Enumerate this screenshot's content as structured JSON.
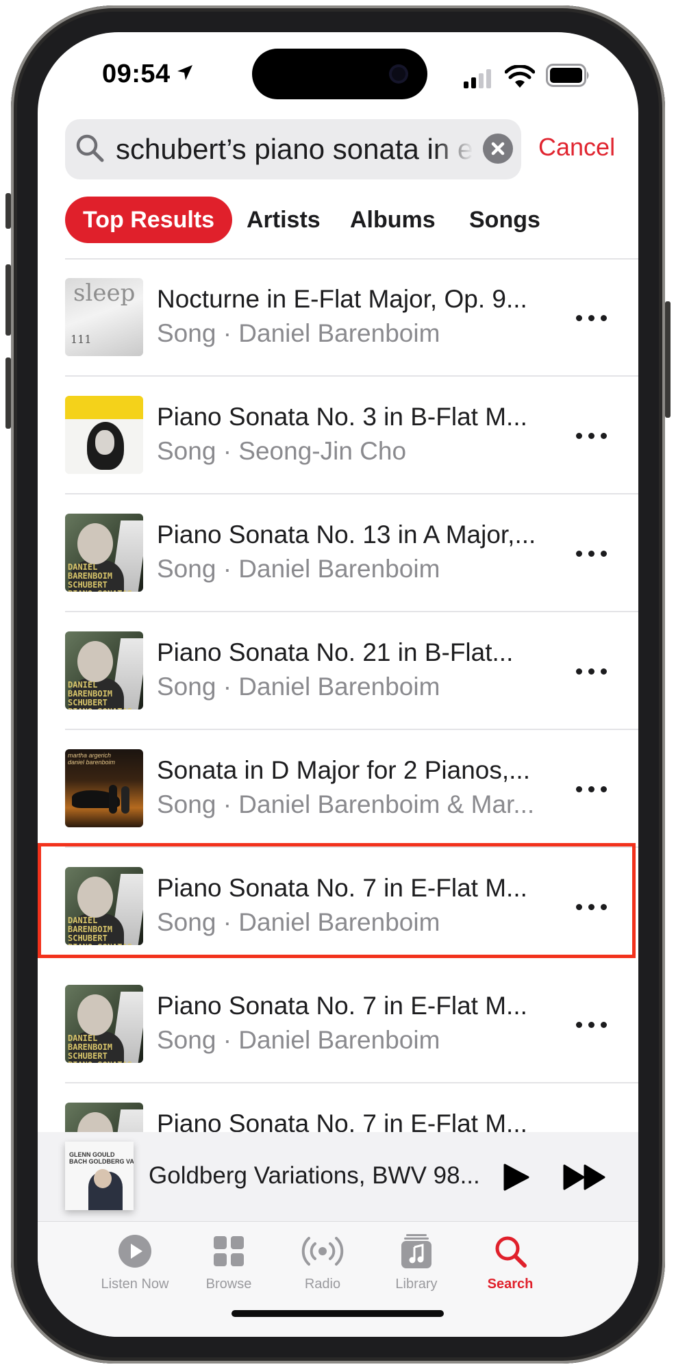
{
  "status_bar": {
    "time": "09:54"
  },
  "search": {
    "query": "schubert’s piano sonata in e",
    "cancel_label": "Cancel"
  },
  "tabs": [
    {
      "label": "Top Results",
      "active": true
    },
    {
      "label": "Artists",
      "active": false
    },
    {
      "label": "Albums",
      "active": false
    },
    {
      "label": "Songs",
      "active": false
    }
  ],
  "results": [
    {
      "title": "Nocturne in E-Flat Major, Op. 9...",
      "subtitle": "Song · Daniel Barenboim",
      "art": "sleep",
      "art_text": "sleep",
      "art_number": "111"
    },
    {
      "title": "Piano Sonata No. 3 in B-Flat M...",
      "subtitle": "Song · Seong-Jin Cho",
      "art": "cho"
    },
    {
      "title": "Piano Sonata No. 13 in A Major,...",
      "subtitle": "Song · Daniel Barenboim",
      "art": "barenboim"
    },
    {
      "title": "Piano Sonata No. 21 in B-Flat...",
      "subtitle": "Song · Daniel Barenboim",
      "art": "barenboim"
    },
    {
      "title": "Sonata in D Major for 2 Pianos,...",
      "subtitle": "Song · Daniel Barenboim & Mar...",
      "art": "argerich"
    },
    {
      "title": "Piano Sonata No. 7 in E-Flat M...",
      "subtitle": "Song · Daniel Barenboim",
      "art": "barenboim",
      "highlighted": true
    },
    {
      "title": "Piano Sonata No. 7 in E-Flat M...",
      "subtitle": "Song · Daniel Barenboim",
      "art": "barenboim"
    },
    {
      "title": "Piano Sonata No. 7 in E-Flat M...",
      "subtitle": "",
      "art": "barenboim"
    }
  ],
  "album_art_text": {
    "barenboim": "DANIEL\nBARENBOIM\nSCHUBERT\nPIANO SONATAS",
    "argerich": "martha argerich\ndaniel barenboim",
    "goldberg": "GLENN GOULD\nBACH GOLDBERG VARIATIONS"
  },
  "now_playing": {
    "title": "Goldberg Variations, BWV 98...",
    "art": "goldberg"
  },
  "tab_bar": [
    {
      "label": "Listen Now",
      "icon": "play-circle-icon",
      "active": false
    },
    {
      "label": "Browse",
      "icon": "grid-icon",
      "active": false
    },
    {
      "label": "Radio",
      "icon": "radio-waves-icon",
      "active": false
    },
    {
      "label": "Library",
      "icon": "music-note-stack-icon",
      "active": false
    },
    {
      "label": "Search",
      "icon": "magnifier-icon",
      "active": true
    }
  ],
  "colors": {
    "accent": "#e0202b",
    "highlight_border": "#f2321c",
    "secondary_text": "#8a8a8e"
  }
}
